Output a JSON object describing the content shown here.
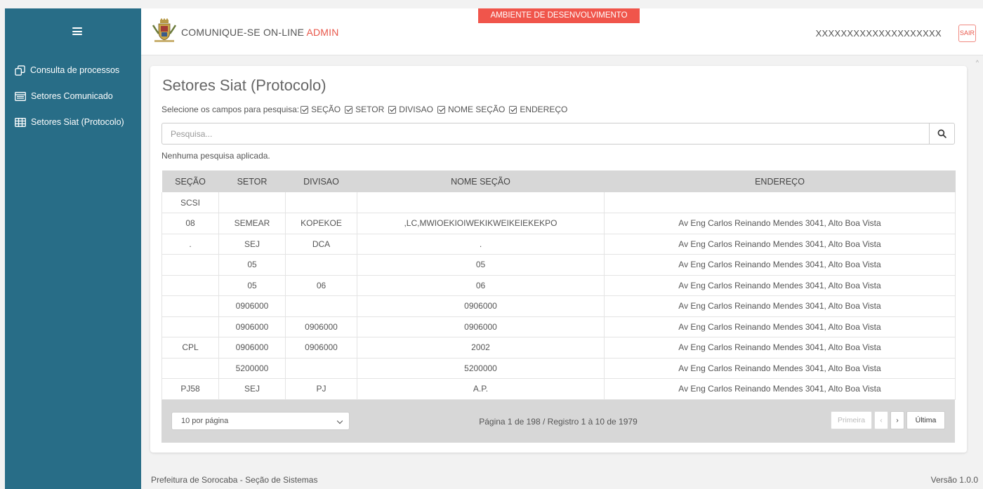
{
  "sidebar": {
    "items": [
      {
        "label": "Consulta de processos",
        "icon": "copy-icon"
      },
      {
        "label": "Setores Comunicado",
        "icon": "list-icon"
      },
      {
        "label": "Setores Siat (Protocolo)",
        "icon": "table-icon"
      }
    ]
  },
  "header": {
    "title": "COMUNIQUE-SE ON-LINE",
    "title_suffix": "ADMIN",
    "env_badge": "AMBIENTE DE DESENVOLVIMENTO",
    "user": "XXXXXXXXXXXXXXXXXXXX",
    "logout_label": "SAIR"
  },
  "main": {
    "title": "Setores Siat (Protocolo)",
    "filter_label": "Selecione os campos para pesquisa:",
    "filters": [
      "SEÇÃO",
      "SETOR",
      "DIVISAO",
      "NOME SEÇÃO",
      "ENDEREÇO"
    ],
    "search_placeholder": "Pesquisa...",
    "search_status": "Nenhuma pesquisa aplicada.",
    "table": {
      "columns": [
        "SEÇÃO",
        "SETOR",
        "DIVISAO",
        "NOME SEÇÃO",
        "ENDEREÇO"
      ],
      "rows": [
        [
          "SCSI",
          "",
          "",
          "",
          ""
        ],
        [
          "08",
          "SEMEAR",
          "KOPEKOE",
          ",LC,MWIOEKIOIWEKIKWEIKEIEKEKPO",
          "Av Eng Carlos Reinando Mendes 3041, Alto Boa Vista"
        ],
        [
          ".",
          "SEJ",
          "DCA",
          ".",
          "Av Eng Carlos Reinando Mendes 3041, Alto Boa Vista"
        ],
        [
          "",
          "05",
          "",
          "05",
          "Av Eng Carlos Reinando Mendes 3041, Alto Boa Vista"
        ],
        [
          "",
          "05",
          "06",
          "06",
          "Av Eng Carlos Reinando Mendes 3041, Alto Boa Vista"
        ],
        [
          "",
          "0906000",
          "",
          "0906000",
          "Av Eng Carlos Reinando Mendes 3041, Alto Boa Vista"
        ],
        [
          "",
          "0906000",
          "0906000",
          "0906000",
          "Av Eng Carlos Reinando Mendes 3041, Alto Boa Vista"
        ],
        [
          "CPL",
          "0906000",
          "0906000",
          "2002",
          "Av Eng Carlos Reinando Mendes 3041, Alto Boa Vista"
        ],
        [
          "",
          "5200000",
          "",
          "5200000",
          "Av Eng Carlos Reinando Mendes 3041, Alto Boa Vista"
        ],
        [
          "PJ58",
          "SEJ",
          "PJ",
          "A.P.",
          "Av Eng Carlos Reinando Mendes 3041, Alto Boa Vista"
        ]
      ]
    },
    "pagination": {
      "page_size": "10 por página",
      "info": "Página 1 de 198 / Registro 1 à 10 de 1979",
      "first": "Primeira",
      "prev": "‹",
      "next": "›",
      "last": "Última"
    }
  },
  "footer": {
    "left": "Prefeitura de Sorocaba - Seção de Sistemas",
    "right": "Versão 1.0.0"
  },
  "colors": {
    "sidebar": "#286d87",
    "accent_red": "#f0554b",
    "table_header": "#d7d7d7"
  }
}
